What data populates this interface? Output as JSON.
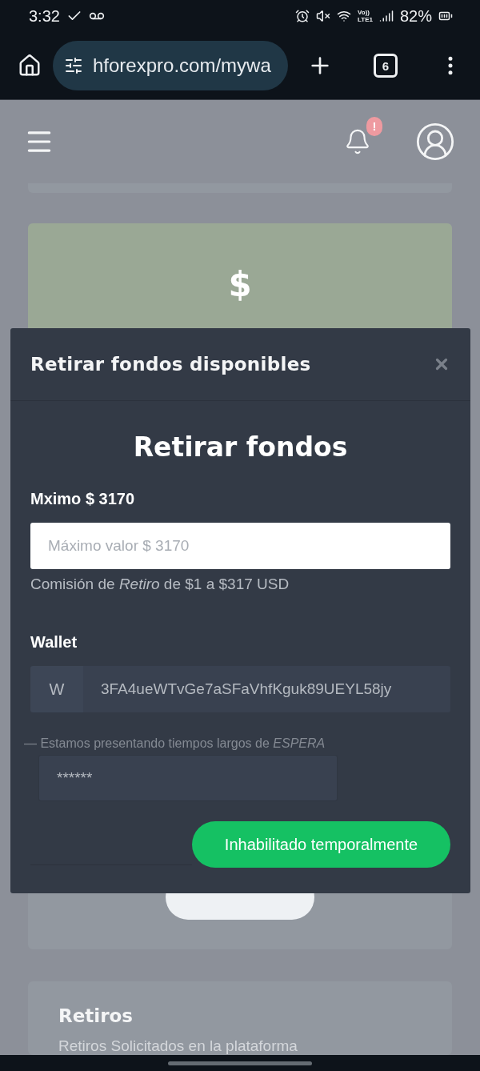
{
  "status_bar": {
    "time": "3:32",
    "network_label": [
      "Vo))",
      "LTE1"
    ],
    "battery": "82%"
  },
  "browser": {
    "url": "hforexpro.com/mywa",
    "tab_count": "6"
  },
  "page": {
    "header": {
      "notification_badge": "!"
    },
    "balance_card": {
      "symbol": "$"
    },
    "withdrawals_card": {
      "title": "Retiros",
      "subtitle": "Retiros Solicitados en la plataforma"
    }
  },
  "modal": {
    "title": "Retirar fondos disponibles",
    "heading": "Retirar fondos",
    "amount": {
      "label": "Mximo $ 3170",
      "placeholder": "Máximo valor $ 3170",
      "commission": "Comisión de *Retiro* de $1 a $317 USD"
    },
    "wallet": {
      "label": "Wallet",
      "prefix": "W",
      "value": "3FA4ueWTvGe7aSFaVhfKguk89UEYL58jy"
    },
    "notice": "— Estamos presentando tiempos largos de *ESPERA*",
    "code_field": {
      "value": "******"
    },
    "submit": {
      "label": "Inhabilitado temporalmente"
    }
  }
}
